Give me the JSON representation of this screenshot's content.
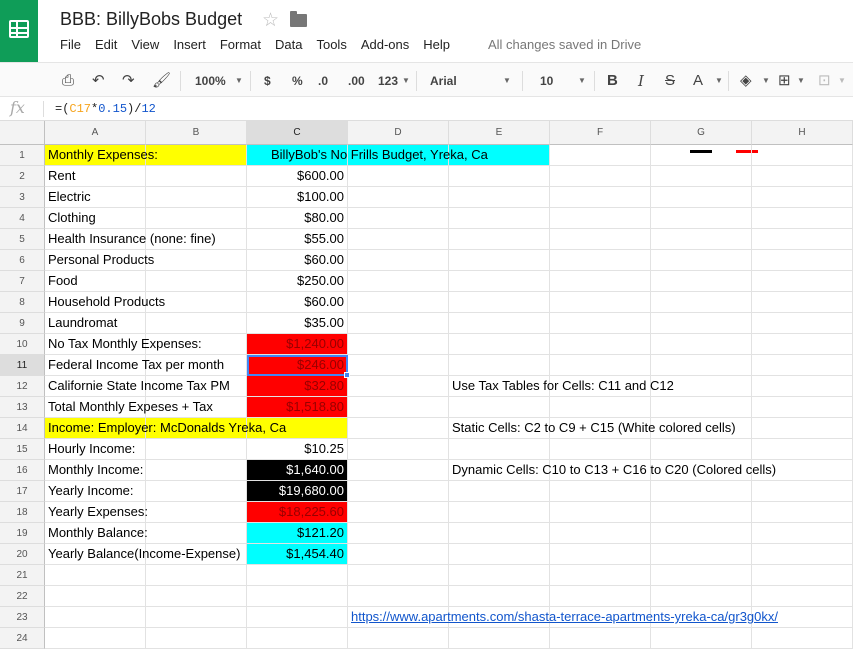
{
  "app": {
    "doc_title": "BBB: BillyBobs Budget",
    "save_status": "All changes saved in Drive",
    "menus": [
      "File",
      "Edit",
      "View",
      "Insert",
      "Format",
      "Data",
      "Tools",
      "Add-ons",
      "Help"
    ]
  },
  "toolbar": {
    "zoom": "100%",
    "currency": "$",
    "percent": "%",
    "decrease_decimal": ".0",
    "increase_decimal": ".00",
    "more_formats": "123",
    "font": "Arial",
    "font_size": "10",
    "bold": "B",
    "italic": "I",
    "strikethrough": "S",
    "text_color_label": "A",
    "text_color": "#000000",
    "fill_color": "#ff0000"
  },
  "formula_bar": {
    "fx": "fx",
    "formula_prefix": "=(",
    "formula_ref": "C17",
    "formula_mid": "*",
    "formula_num1": "0.15",
    "formula_close": ")/",
    "formula_num2": "12"
  },
  "grid": {
    "columns": [
      "A",
      "B",
      "C",
      "D",
      "E",
      "F",
      "G",
      "H"
    ],
    "active_column": "C",
    "active_row": 11,
    "row_numbers": [
      "1",
      "2",
      "3",
      "4",
      "5",
      "6",
      "7",
      "8",
      "9",
      "10",
      "11",
      "12",
      "13",
      "14",
      "15",
      "16",
      "17",
      "18",
      "19",
      "20",
      "21",
      "22",
      "23",
      "24"
    ],
    "cells": {
      "A1": "Monthly Expenses:",
      "C1": "BillyBob's No Frills Budget, Yreka, Ca",
      "A2": "Rent",
      "C2": "$600.00",
      "A3": "Electric",
      "C3": "$100.00",
      "A4": "Clothing",
      "C4": "$80.00",
      "A5": "Health Insurance (none: fine)",
      "C5": "$55.00",
      "A6": "Personal Products",
      "C6": "$60.00",
      "A7": "Food",
      "C7": "$250.00",
      "A8": "Household Products",
      "C8": "$60.00",
      "A9": "Laundromat",
      "C9": "$35.00",
      "A10": "No Tax Monthly Expenses:",
      "C10": "$1,240.00",
      "A11": "Federal Income Tax per month",
      "C11": "$246.00",
      "A12": "Californie State Income Tax PM",
      "C12": "$32.80",
      "E12": "Use Tax Tables for Cells: C11 and C12",
      "A13": "Total Monthly Expeses + Tax",
      "C13": "$1,518.80",
      "A14": "Income: Employer: McDonalds Yreka, Ca",
      "E14": "Static Cells: C2 to C9 + C15 (White colored cells)",
      "A15": "Hourly Income:",
      "C15": "$10.25",
      "A16": "Monthly Income:",
      "C16": "$1,640.00",
      "E16": "Dynamic Cells: C10 to C13 + C16 to C20 (Colored cells)",
      "A17": "Yearly Income:",
      "C17": "$19,680.00",
      "A18": "Yearly Expenses:",
      "C18": "$18,225.60",
      "A19": "Monthly Balance:",
      "C19": "$121.20",
      "A20": "Yearly Balance(Income-Expense)",
      "C20": "$1,454.40",
      "D23": "https://www.apartments.com/shasta-terrace-apartments-yreka-ca/gr3g0kx/"
    }
  },
  "colors": {
    "yellow": "#ffff00",
    "cyan": "#00ffff",
    "red": "#ff0000",
    "black": "#000000",
    "selection": "#4285f4",
    "brand": "#0f9d58"
  }
}
